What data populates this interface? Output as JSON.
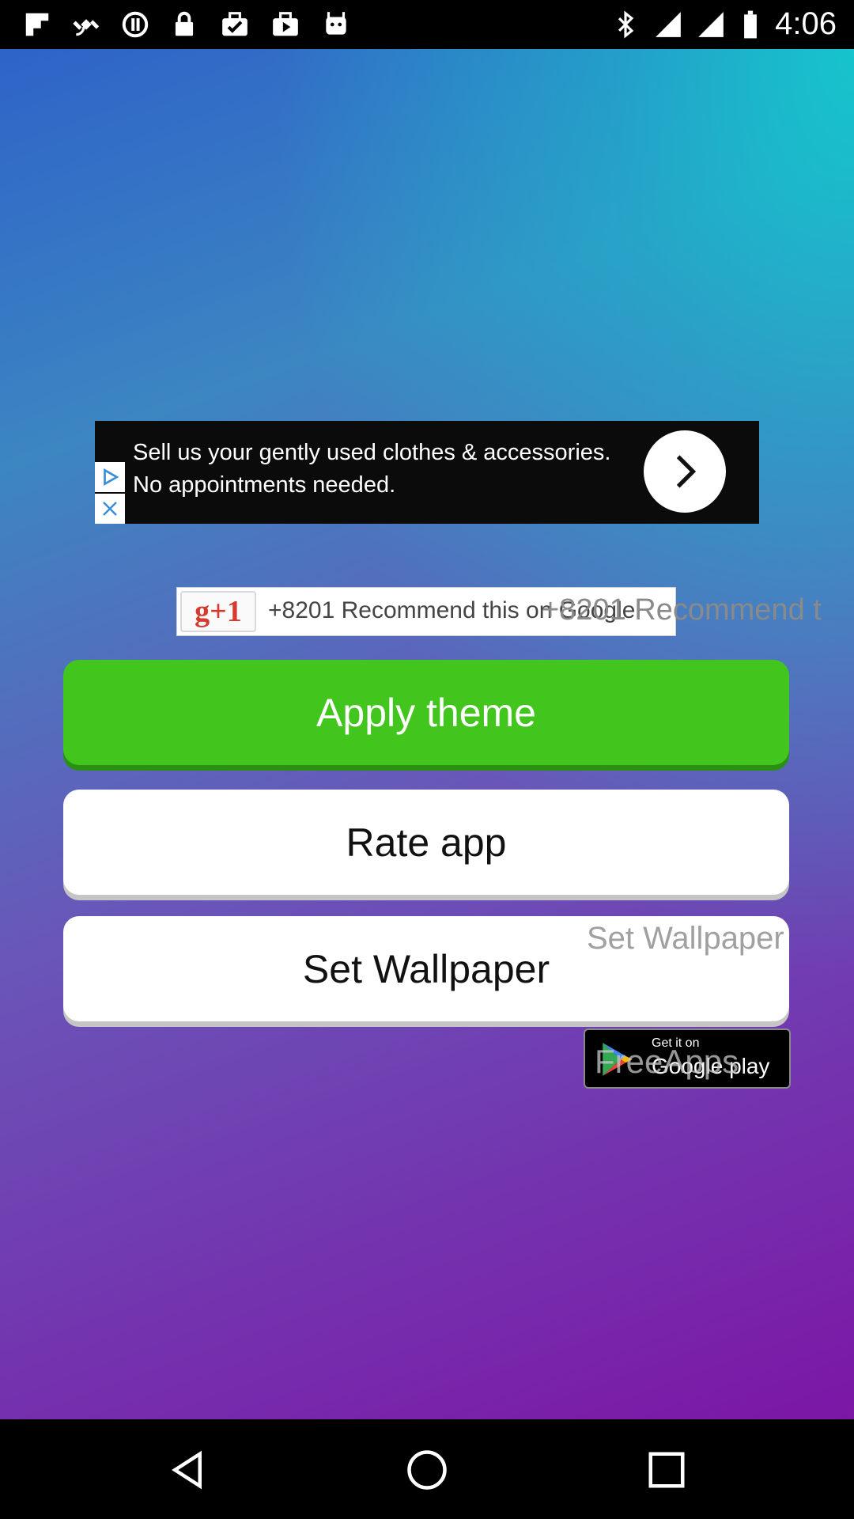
{
  "status_bar": {
    "time": "4:06",
    "left_icons": [
      "flipboard-icon",
      "fake-gps-icon",
      "sync-icon",
      "lock-icon",
      "briefcase-check-icon",
      "briefcase-play-icon",
      "android-icon"
    ],
    "right_icons": [
      "bluetooth-icon",
      "wifi-signal-icon",
      "cell-signal-icon",
      "battery-icon"
    ]
  },
  "ad": {
    "text": "Sell us your gently used clothes & accessories. No appointments needed."
  },
  "gplus": {
    "button_label": "g+1",
    "recommend_text": "+8201 Recommend this on Google",
    "overlay_text": "+8201 Recommend t"
  },
  "buttons": {
    "apply_theme": "Apply theme",
    "rate_app": "Rate app",
    "set_wallpaper": "Set Wallpaper"
  },
  "overlays": {
    "set_wallpaper": "Set Wallpaper",
    "free_apps": "FreeApps"
  },
  "play_badge": {
    "small": "Get it on",
    "big": "Google play"
  },
  "colors": {
    "apply_theme": "#42c61e",
    "gradient_top": "#2E63C8",
    "gradient_teal": "#14C8CD",
    "gradient_bottom": "#7C16A6"
  }
}
